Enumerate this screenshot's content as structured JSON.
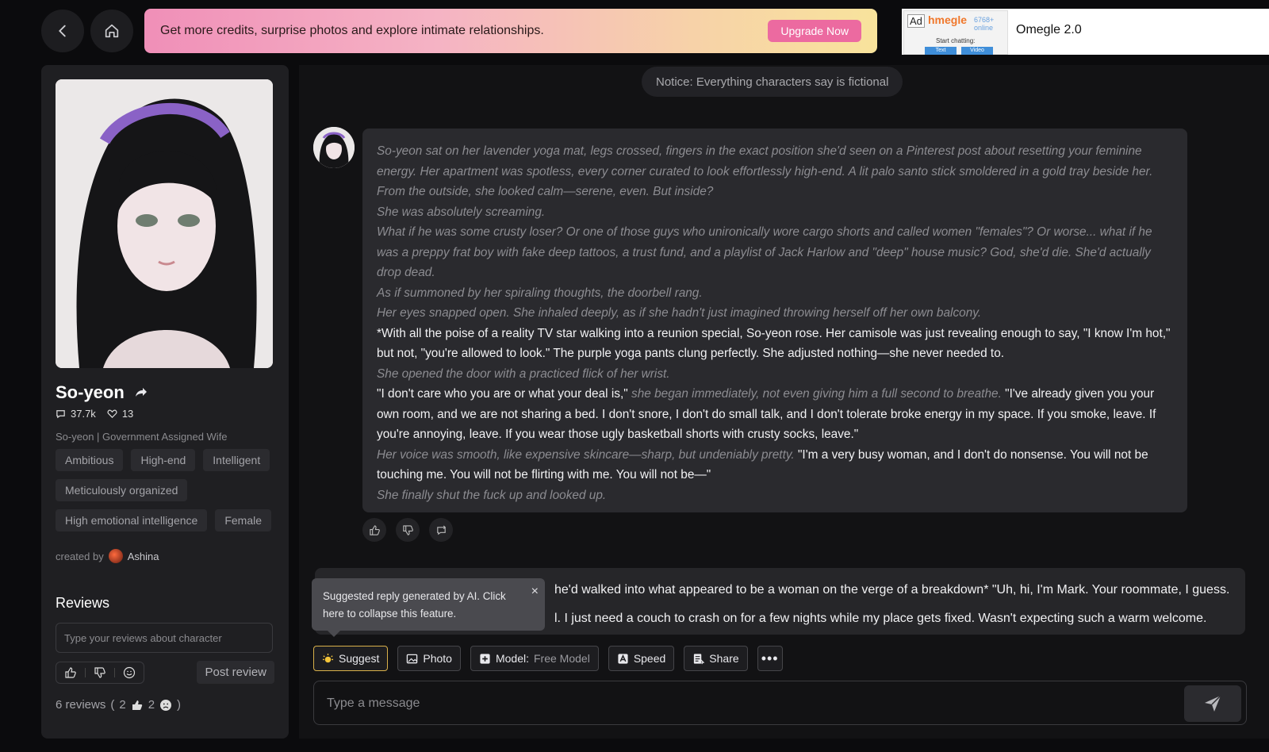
{
  "nav": {
    "back_icon": "chevron-left-icon",
    "home_icon": "home-icon"
  },
  "promo": {
    "text": "Get more credits, surprise photos and explore intimate relationships.",
    "cta": "Upgrade Now"
  },
  "ad": {
    "label": "Ad",
    "brand": "hmegle",
    "count": "6768+ online",
    "start": "Start chatting:",
    "opt1": "Text",
    "opt2": "Video",
    "title": "Omegle 2.0"
  },
  "character": {
    "name": "So-yeon",
    "chats": "37.7k",
    "likes": "13",
    "subtitle": "So-yeon | Government Assigned Wife",
    "tags": [
      "Ambitious",
      "High-end",
      "Intelligent",
      "Meticulously organized",
      "High emotional intelligence",
      "Female"
    ],
    "created_by_label": "created by",
    "creator": "Ashina"
  },
  "reviews": {
    "title": "Reviews",
    "placeholder": "Type your reviews about character",
    "post": "Post review",
    "count_text": "6 reviews",
    "likes": "2",
    "dislikes": "2"
  },
  "chat": {
    "notice": "Notice: Everything characters say is fictional",
    "message": {
      "p1": "So-yeon sat on her lavender yoga mat, legs crossed, fingers in the exact position she'd seen on a Pinterest post about resetting your feminine energy. Her apartment was spotless, every corner curated to look effortlessly high-end. A lit palo santo stick smoldered in a gold tray beside her. From the outside, she looked calm—serene, even. But inside?",
      "p2": "She was absolutely screaming.",
      "p3": "What if he was some crusty loser? Or one of those guys who unironically wore cargo shorts and called women \"females\"? Or worse... what if he was a preppy frat boy with fake deep tattoos, a trust fund, and a playlist of Jack Harlow and \"deep\" house music? God, she'd die. She'd actually drop dead.",
      "p4": "As if summoned by her spiraling thoughts, the doorbell rang.",
      "p5": "Her eyes snapped open. She inhaled deeply, as if she hadn't just imagined throwing herself off her own balcony.",
      "p6": "*With all the poise of a reality TV star walking into a reunion special, So-yeon rose. Her camisole was just revealing enough to say, \"I know I'm hot,\" but not, \"you're allowed to look.\" The purple yoga pants clung perfectly. She adjusted nothing—she never needed to.",
      "p7": "She opened the door with a practiced flick of her wrist.",
      "p8a": "\"I don't care who you are or what your deal is,\"",
      "p8b": "she began immediately, not even giving him a full second to breathe.",
      "p8c": "\"I've already given you your own room, and we are not sharing a bed. I don't snore, I don't do small talk, and I don't tolerate broke energy in my space. If you smoke, leave. If you're annoying, leave. If you wear those ugly basketball shorts with crusty socks, leave.\"",
      "p9a": "Her voice was smooth, like expensive skincare—sharp, but undeniably pretty.",
      "p9b": "\"I'm a very busy woman, and I don't do nonsense. You will not be touching me. You will not be flirting with me. You will not be—\"",
      "p10": "She finally shut the fuck up and looked up."
    },
    "suggestion_line1": "he'd walked into what appeared to be a woman on the verge of a breakdown* \"Uh, hi, I'm Mark. Your roommate, I guess.",
    "suggestion_line2": "l. I just need a couch to crash on for a few nights while my place gets fixed. Wasn't expecting such a warm welcome.",
    "tooltip": "Suggested reply generated by AI. Click here to collapse this feature.",
    "tooltip_close": "×",
    "toolbar": {
      "suggest": "Suggest",
      "photo": "Photo",
      "model_label": "Model:",
      "model_value": "Free Model",
      "speed": "Speed",
      "share": "Share",
      "more": "•••"
    },
    "input_placeholder": "Type a message"
  }
}
